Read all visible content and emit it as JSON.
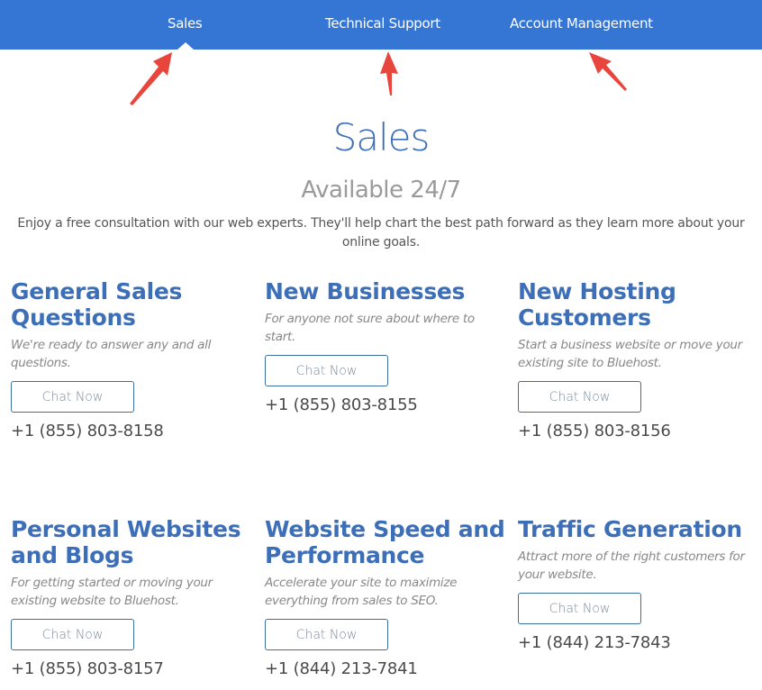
{
  "nav": {
    "items": [
      {
        "label": "Sales",
        "active": true
      },
      {
        "label": "Technical Support",
        "active": false
      },
      {
        "label": "Account Management",
        "active": false
      }
    ],
    "background_color": "#3576d4"
  },
  "annotations": {
    "arrow_color": "#e8453c",
    "arrows": [
      "arrow-to-sales",
      "arrow-to-technical-support",
      "arrow-to-account-management"
    ]
  },
  "header": {
    "title": "Sales",
    "subtitle": "Available 24/7",
    "description": "Enjoy a free consultation with our web experts. They'll help chart the best path forward as they learn more about your online goals."
  },
  "cards": [
    {
      "title": "General Sales Questions",
      "description": "We're ready to answer any and all questions.",
      "button": "Chat Now",
      "phone": "+1 (855) 803-8158"
    },
    {
      "title": "New Businesses",
      "description": "For anyone not sure about where to start.",
      "button": "Chat Now",
      "phone": "+1 (855) 803-8155"
    },
    {
      "title": "New Hosting Customers",
      "description": "Start a business website or move your existing site to Bluehost.",
      "button": "Chat Now",
      "phone": "+1 (855) 803-8156"
    },
    {
      "title": "Personal Websites and Blogs",
      "description": "For getting started or moving your existing website to Bluehost.",
      "button": "Chat Now",
      "phone": "+1 (855) 803-8157"
    },
    {
      "title": "Website Speed and Performance",
      "description": "Accelerate your site to maximize everything from sales to SEO.",
      "button": "Chat Now",
      "phone": "+1 (844) 213-7841"
    },
    {
      "title": "Traffic Generation",
      "description": "Attract more of the right customers for your website.",
      "button": "Chat Now",
      "phone": "+1 (844) 213-7843"
    }
  ],
  "colors": {
    "accent": "#3d6fb8",
    "subtitle": "#9a9a9a",
    "body_text": "#555555",
    "button_border": "#3d6f9e"
  }
}
